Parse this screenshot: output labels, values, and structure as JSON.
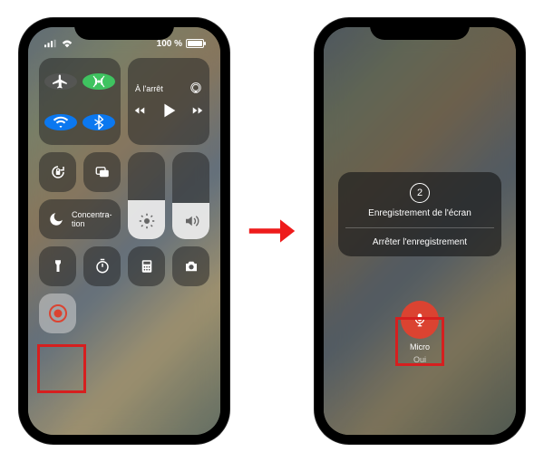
{
  "status": {
    "battery_text": "100 %"
  },
  "media": {
    "title": "À l'arrêt"
  },
  "focus": {
    "label": "Concentra-\ntion"
  },
  "recording_panel": {
    "countdown": "2",
    "title": "Enregistrement de l'écran",
    "stop_label": "Arrêter l'enregistrement"
  },
  "mic": {
    "label": "Micro",
    "state": "Oui"
  },
  "colors": {
    "highlight": "#e61b1b",
    "arrow": "#ee1b1b",
    "toggle_green": "#34c759",
    "toggle_blue": "#007aff",
    "mic_red": "#e8402c"
  }
}
